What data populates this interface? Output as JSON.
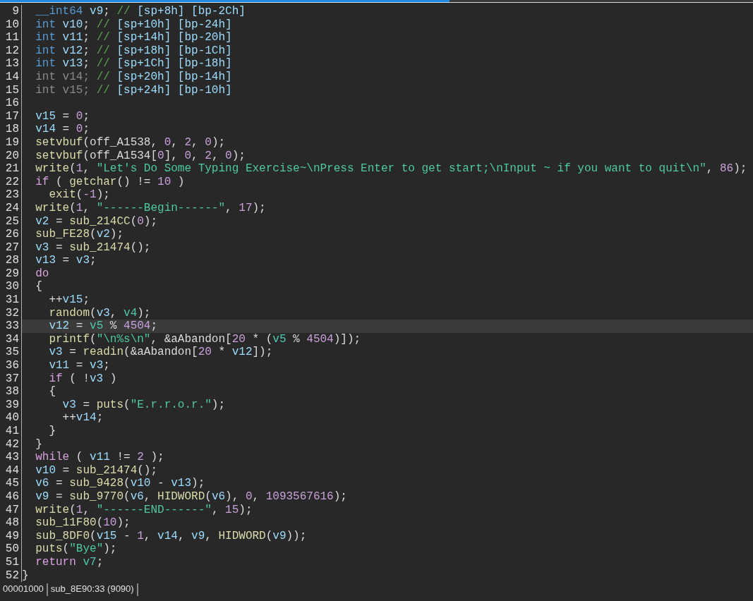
{
  "lines": [
    {
      "number": "9",
      "selected": false,
      "tokens": [
        {
          "kind": "type",
          "text": "  __int64"
        },
        {
          "kind": "var",
          "text": " v9"
        },
        {
          "kind": "p",
          "text": "; "
        },
        {
          "kind": "cmt",
          "text": "//"
        },
        {
          "kind": "ref",
          "text": " [sp+8h] [bp-2Ch]"
        }
      ]
    },
    {
      "number": "10",
      "selected": false,
      "tokens": [
        {
          "kind": "type",
          "text": "  int"
        },
        {
          "kind": "var",
          "text": " v10"
        },
        {
          "kind": "p",
          "text": "; "
        },
        {
          "kind": "cmt",
          "text": "//"
        },
        {
          "kind": "ref",
          "text": " [sp+10h] [bp-24h]"
        }
      ]
    },
    {
      "number": "11",
      "selected": false,
      "tokens": [
        {
          "kind": "type",
          "text": "  int"
        },
        {
          "kind": "var",
          "text": " v11"
        },
        {
          "kind": "p",
          "text": "; "
        },
        {
          "kind": "cmt",
          "text": "//"
        },
        {
          "kind": "ref",
          "text": " [sp+14h] [bp-20h]"
        }
      ]
    },
    {
      "number": "12",
      "selected": false,
      "tokens": [
        {
          "kind": "type",
          "text": "  int"
        },
        {
          "kind": "var",
          "text": " v12"
        },
        {
          "kind": "p",
          "text": "; "
        },
        {
          "kind": "cmt",
          "text": "//"
        },
        {
          "kind": "ref",
          "text": " [sp+18h] [bp-1Ch]"
        }
      ]
    },
    {
      "number": "13",
      "selected": false,
      "tokens": [
        {
          "kind": "type",
          "text": "  int"
        },
        {
          "kind": "var",
          "text": " v13"
        },
        {
          "kind": "p",
          "text": "; "
        },
        {
          "kind": "cmt",
          "text": "//"
        },
        {
          "kind": "ref",
          "text": " [sp+1Ch] [bp-18h]"
        }
      ]
    },
    {
      "number": "14",
      "selected": false,
      "tokens": [
        {
          "kind": "dim",
          "text": "  int v14; "
        },
        {
          "kind": "cmt",
          "text": "//"
        },
        {
          "kind": "ref",
          "text": " [sp+20h] [bp-14h]"
        }
      ]
    },
    {
      "number": "15",
      "selected": false,
      "tokens": [
        {
          "kind": "dim",
          "text": "  int v15; "
        },
        {
          "kind": "cmt",
          "text": "//"
        },
        {
          "kind": "ref",
          "text": " [sp+24h] [bp-10h]"
        }
      ]
    },
    {
      "number": "16",
      "selected": false
    },
    {
      "number": "17",
      "selected": false,
      "tokens": [
        {
          "kind": "var",
          "text": "  v15"
        },
        {
          "kind": "p",
          "text": " = "
        },
        {
          "kind": "num",
          "text": "0"
        },
        {
          "kind": "p",
          "text": ";"
        }
      ]
    },
    {
      "number": "18",
      "selected": false,
      "tokens": [
        {
          "kind": "var",
          "text": "  v14"
        },
        {
          "kind": "p",
          "text": " = "
        },
        {
          "kind": "num",
          "text": "0"
        },
        {
          "kind": "p",
          "text": ";"
        }
      ]
    },
    {
      "number": "19",
      "selected": false,
      "tokens": [
        {
          "kind": "fn",
          "text": "  setvbuf"
        },
        {
          "kind": "p",
          "text": "("
        },
        {
          "kind": "glob",
          "text": "off_A1538"
        },
        {
          "kind": "p",
          "text": ", "
        },
        {
          "kind": "num",
          "text": "0"
        },
        {
          "kind": "p",
          "text": ", "
        },
        {
          "kind": "num",
          "text": "2"
        },
        {
          "kind": "p",
          "text": ", "
        },
        {
          "kind": "num",
          "text": "0"
        },
        {
          "kind": "p",
          "text": ");"
        }
      ]
    },
    {
      "number": "20",
      "selected": false,
      "tokens": [
        {
          "kind": "fn",
          "text": "  setvbuf"
        },
        {
          "kind": "p",
          "text": "("
        },
        {
          "kind": "glob",
          "text": "off_A1534"
        },
        {
          "kind": "p",
          "text": "["
        },
        {
          "kind": "num",
          "text": "0"
        },
        {
          "kind": "p",
          "text": "], "
        },
        {
          "kind": "num",
          "text": "0"
        },
        {
          "kind": "p",
          "text": ", "
        },
        {
          "kind": "num",
          "text": "2"
        },
        {
          "kind": "p",
          "text": ", "
        },
        {
          "kind": "num",
          "text": "0"
        },
        {
          "kind": "p",
          "text": ");"
        }
      ]
    },
    {
      "number": "21",
      "selected": false,
      "tokens": [
        {
          "kind": "fn",
          "text": "  write"
        },
        {
          "kind": "p",
          "text": "("
        },
        {
          "kind": "num",
          "text": "1"
        },
        {
          "kind": "p",
          "text": ", "
        },
        {
          "kind": "str",
          "text": "\"Let's Do Some Typing Exercise~\\nPress Enter to get start;\\nInput ~ if you want to quit\\n\""
        },
        {
          "kind": "p",
          "text": ", "
        },
        {
          "kind": "num",
          "text": "86"
        },
        {
          "kind": "p",
          "text": ");"
        }
      ]
    },
    {
      "number": "22",
      "selected": false,
      "tokens": [
        {
          "kind": "kw",
          "text": "  if"
        },
        {
          "kind": "p",
          "text": " ( "
        },
        {
          "kind": "fn",
          "text": "getchar"
        },
        {
          "kind": "p",
          "text": "() != "
        },
        {
          "kind": "num",
          "text": "10"
        },
        {
          "kind": "p",
          "text": " )"
        }
      ]
    },
    {
      "number": "23",
      "selected": false,
      "tokens": [
        {
          "kind": "fn",
          "text": "    exit"
        },
        {
          "kind": "p",
          "text": "("
        },
        {
          "kind": "num",
          "text": "-1"
        },
        {
          "kind": "p",
          "text": ");"
        }
      ]
    },
    {
      "number": "24",
      "selected": false,
      "tokens": [
        {
          "kind": "fn",
          "text": "  write"
        },
        {
          "kind": "p",
          "text": "("
        },
        {
          "kind": "num",
          "text": "1"
        },
        {
          "kind": "p",
          "text": ", "
        },
        {
          "kind": "str",
          "text": "\"------Begin------\""
        },
        {
          "kind": "p",
          "text": ", "
        },
        {
          "kind": "num",
          "text": "17"
        },
        {
          "kind": "p",
          "text": ");"
        }
      ]
    },
    {
      "number": "25",
      "selected": false,
      "tokens": [
        {
          "kind": "var",
          "text": "  v2"
        },
        {
          "kind": "p",
          "text": " = "
        },
        {
          "kind": "fn",
          "text": "sub_214CC"
        },
        {
          "kind": "p",
          "text": "("
        },
        {
          "kind": "num",
          "text": "0"
        },
        {
          "kind": "p",
          "text": ");"
        }
      ]
    },
    {
      "number": "26",
      "selected": false,
      "tokens": [
        {
          "kind": "fn",
          "text": "  sub_FE28"
        },
        {
          "kind": "p",
          "text": "("
        },
        {
          "kind": "var",
          "text": "v2"
        },
        {
          "kind": "p",
          "text": ");"
        }
      ]
    },
    {
      "number": "27",
      "selected": false,
      "tokens": [
        {
          "kind": "var",
          "text": "  v3"
        },
        {
          "kind": "p",
          "text": " = "
        },
        {
          "kind": "fn",
          "text": "sub_21474"
        },
        {
          "kind": "p",
          "text": "();"
        }
      ]
    },
    {
      "number": "28",
      "selected": false,
      "tokens": [
        {
          "kind": "var",
          "text": "  v13"
        },
        {
          "kind": "p",
          "text": " = "
        },
        {
          "kind": "var",
          "text": "v3"
        },
        {
          "kind": "p",
          "text": ";"
        }
      ]
    },
    {
      "number": "29",
      "selected": false,
      "tokens": [
        {
          "kind": "kw",
          "text": "  do"
        }
      ]
    },
    {
      "number": "30",
      "selected": false,
      "tokens": [
        {
          "kind": "p",
          "text": "  {"
        }
      ]
    },
    {
      "number": "31",
      "selected": false,
      "tokens": [
        {
          "kind": "p",
          "text": "    ++"
        },
        {
          "kind": "var",
          "text": "v15"
        },
        {
          "kind": "p",
          "text": ";"
        }
      ]
    },
    {
      "number": "32",
      "selected": false,
      "tokens": [
        {
          "kind": "fn",
          "text": "    random"
        },
        {
          "kind": "p",
          "text": "("
        },
        {
          "kind": "var",
          "text": "v3"
        },
        {
          "kind": "p",
          "text": ", "
        },
        {
          "kind": "uvar",
          "text": "v4"
        },
        {
          "kind": "p",
          "text": ");"
        }
      ]
    },
    {
      "number": "33",
      "selected": true,
      "tokens": [
        {
          "kind": "var",
          "text": "    v12"
        },
        {
          "kind": "p",
          "text": " = "
        },
        {
          "kind": "uvar",
          "text": "v5"
        },
        {
          "kind": "p",
          "text": " % "
        },
        {
          "kind": "num",
          "text": "4504"
        },
        {
          "kind": "p",
          "text": ";"
        }
      ]
    },
    {
      "number": "34",
      "selected": false,
      "tokens": [
        {
          "kind": "fn",
          "text": "    printf"
        },
        {
          "kind": "p",
          "text": "("
        },
        {
          "kind": "str",
          "text": "\"\\n%s\\n\""
        },
        {
          "kind": "p",
          "text": ", &"
        },
        {
          "kind": "glob",
          "text": "aAbandon"
        },
        {
          "kind": "p",
          "text": "["
        },
        {
          "kind": "num",
          "text": "20"
        },
        {
          "kind": "p",
          "text": " * ("
        },
        {
          "kind": "uvar",
          "text": "v5"
        },
        {
          "kind": "p",
          "text": " % "
        },
        {
          "kind": "num",
          "text": "4504"
        },
        {
          "kind": "p",
          "text": ")]);"
        }
      ]
    },
    {
      "number": "35",
      "selected": false,
      "tokens": [
        {
          "kind": "var",
          "text": "    v3"
        },
        {
          "kind": "p",
          "text": " = "
        },
        {
          "kind": "fn",
          "text": "readin"
        },
        {
          "kind": "p",
          "text": "(&"
        },
        {
          "kind": "glob",
          "text": "aAbandon"
        },
        {
          "kind": "p",
          "text": "["
        },
        {
          "kind": "num",
          "text": "20"
        },
        {
          "kind": "p",
          "text": " * "
        },
        {
          "kind": "var",
          "text": "v12"
        },
        {
          "kind": "p",
          "text": "]);"
        }
      ]
    },
    {
      "number": "36",
      "selected": false,
      "tokens": [
        {
          "kind": "var",
          "text": "    v11"
        },
        {
          "kind": "p",
          "text": " = "
        },
        {
          "kind": "var",
          "text": "v3"
        },
        {
          "kind": "p",
          "text": ";"
        }
      ]
    },
    {
      "number": "37",
      "selected": false,
      "tokens": [
        {
          "kind": "kw",
          "text": "    if"
        },
        {
          "kind": "p",
          "text": " ( !"
        },
        {
          "kind": "var",
          "text": "v3"
        },
        {
          "kind": "p",
          "text": " )"
        }
      ]
    },
    {
      "number": "38",
      "selected": false,
      "tokens": [
        {
          "kind": "p",
          "text": "    {"
        }
      ]
    },
    {
      "number": "39",
      "selected": false,
      "tokens": [
        {
          "kind": "var",
          "text": "      v3"
        },
        {
          "kind": "p",
          "text": " = "
        },
        {
          "kind": "fn",
          "text": "puts"
        },
        {
          "kind": "p",
          "text": "("
        },
        {
          "kind": "str",
          "text": "\"E.r.r.o.r.\""
        },
        {
          "kind": "p",
          "text": ");"
        }
      ]
    },
    {
      "number": "40",
      "selected": false,
      "tokens": [
        {
          "kind": "p",
          "text": "      ++"
        },
        {
          "kind": "var",
          "text": "v14"
        },
        {
          "kind": "p",
          "text": ";"
        }
      ]
    },
    {
      "number": "41",
      "selected": false,
      "tokens": [
        {
          "kind": "p",
          "text": "    }"
        }
      ]
    },
    {
      "number": "42",
      "selected": false,
      "tokens": [
        {
          "kind": "p",
          "text": "  }"
        }
      ]
    },
    {
      "number": "43",
      "selected": false,
      "tokens": [
        {
          "kind": "kw",
          "text": "  while"
        },
        {
          "kind": "p",
          "text": " ( "
        },
        {
          "kind": "var",
          "text": "v11"
        },
        {
          "kind": "p",
          "text": " != "
        },
        {
          "kind": "num",
          "text": "2"
        },
        {
          "kind": "p",
          "text": " );"
        }
      ]
    },
    {
      "number": "44",
      "selected": false,
      "tokens": [
        {
          "kind": "var",
          "text": "  v10"
        },
        {
          "kind": "p",
          "text": " = "
        },
        {
          "kind": "fn",
          "text": "sub_21474"
        },
        {
          "kind": "p",
          "text": "();"
        }
      ]
    },
    {
      "number": "45",
      "selected": false,
      "tokens": [
        {
          "kind": "var",
          "text": "  v6"
        },
        {
          "kind": "p",
          "text": " = "
        },
        {
          "kind": "fn",
          "text": "sub_9428"
        },
        {
          "kind": "p",
          "text": "("
        },
        {
          "kind": "var",
          "text": "v10"
        },
        {
          "kind": "p",
          "text": " - "
        },
        {
          "kind": "var",
          "text": "v13"
        },
        {
          "kind": "p",
          "text": ");"
        }
      ]
    },
    {
      "number": "46",
      "selected": false,
      "tokens": [
        {
          "kind": "var",
          "text": "  v9"
        },
        {
          "kind": "p",
          "text": " = "
        },
        {
          "kind": "fn",
          "text": "sub_9770"
        },
        {
          "kind": "p",
          "text": "("
        },
        {
          "kind": "var",
          "text": "v6"
        },
        {
          "kind": "p",
          "text": ", "
        },
        {
          "kind": "fn",
          "text": "HIDWORD"
        },
        {
          "kind": "p",
          "text": "("
        },
        {
          "kind": "var",
          "text": "v6"
        },
        {
          "kind": "p",
          "text": "), "
        },
        {
          "kind": "num",
          "text": "0"
        },
        {
          "kind": "p",
          "text": ", "
        },
        {
          "kind": "num",
          "text": "1093567616"
        },
        {
          "kind": "p",
          "text": ");"
        }
      ]
    },
    {
      "number": "47",
      "selected": false,
      "tokens": [
        {
          "kind": "fn",
          "text": "  write"
        },
        {
          "kind": "p",
          "text": "("
        },
        {
          "kind": "num",
          "text": "1"
        },
        {
          "kind": "p",
          "text": ", "
        },
        {
          "kind": "str",
          "text": "\"------END------\""
        },
        {
          "kind": "p",
          "text": ", "
        },
        {
          "kind": "num",
          "text": "15"
        },
        {
          "kind": "p",
          "text": ");"
        }
      ]
    },
    {
      "number": "48",
      "selected": false,
      "tokens": [
        {
          "kind": "fn",
          "text": "  sub_11F80"
        },
        {
          "kind": "p",
          "text": "("
        },
        {
          "kind": "num",
          "text": "10"
        },
        {
          "kind": "p",
          "text": ");"
        }
      ]
    },
    {
      "number": "49",
      "selected": false,
      "tokens": [
        {
          "kind": "fn",
          "text": "  sub_8DF0"
        },
        {
          "kind": "p",
          "text": "("
        },
        {
          "kind": "var",
          "text": "v15"
        },
        {
          "kind": "p",
          "text": " - "
        },
        {
          "kind": "num",
          "text": "1"
        },
        {
          "kind": "p",
          "text": ", "
        },
        {
          "kind": "var",
          "text": "v14"
        },
        {
          "kind": "p",
          "text": ", "
        },
        {
          "kind": "var",
          "text": "v9"
        },
        {
          "kind": "p",
          "text": ", "
        },
        {
          "kind": "fn",
          "text": "HIDWORD"
        },
        {
          "kind": "p",
          "text": "("
        },
        {
          "kind": "var",
          "text": "v9"
        },
        {
          "kind": "p",
          "text": "));"
        }
      ]
    },
    {
      "number": "50",
      "selected": false,
      "tokens": [
        {
          "kind": "fn",
          "text": "  puts"
        },
        {
          "kind": "p",
          "text": "("
        },
        {
          "kind": "str",
          "text": "\"Bye\""
        },
        {
          "kind": "p",
          "text": ");"
        }
      ]
    },
    {
      "number": "51",
      "selected": false,
      "tokens": [
        {
          "kind": "kw",
          "text": "  return"
        },
        {
          "kind": "uvar",
          "text": " v7"
        },
        {
          "kind": "p",
          "text": ";"
        }
      ]
    },
    {
      "number": "52",
      "selected": false,
      "tokens": [
        {
          "kind": "p",
          "text": "}"
        }
      ]
    }
  ],
  "status_bar": {
    "address": "00001000",
    "location": "sub_8E90:33 (9090)"
  }
}
